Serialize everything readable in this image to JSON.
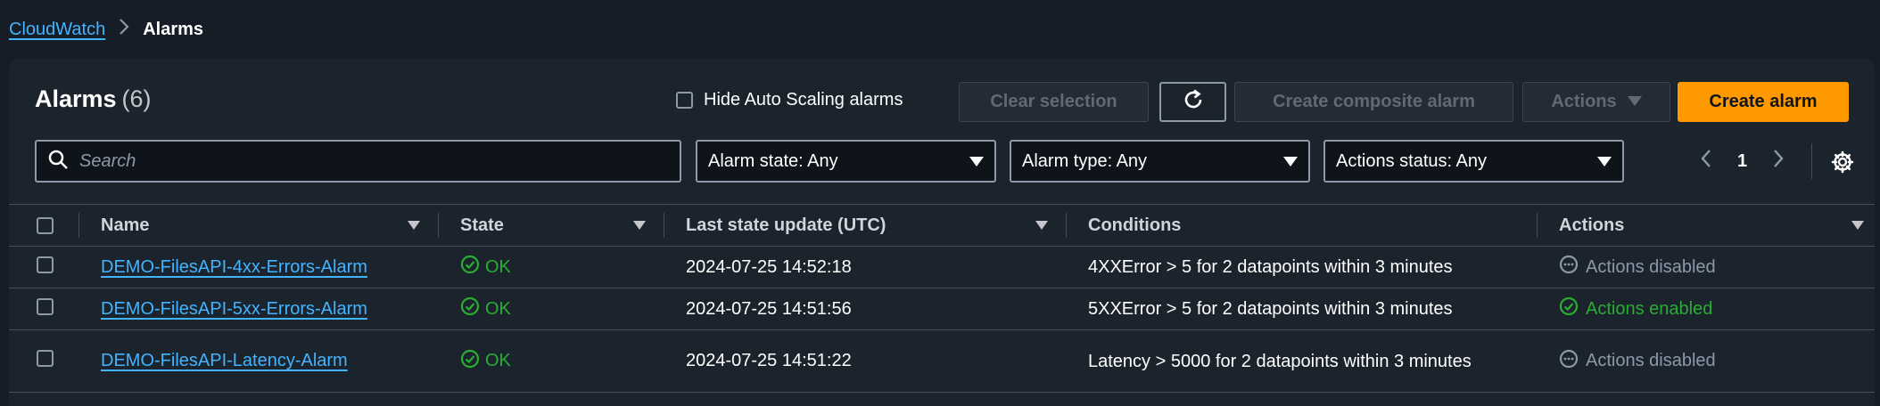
{
  "breadcrumb": {
    "root": "CloudWatch",
    "separator": ">",
    "current": "Alarms"
  },
  "header": {
    "title": "Alarms",
    "count": "(6)"
  },
  "toolbar": {
    "hide_autoscaling_label": "Hide Auto Scaling alarms",
    "clear_selection": "Clear selection",
    "create_composite": "Create composite alarm",
    "actions": "Actions",
    "create_alarm": "Create alarm"
  },
  "filters": {
    "search_placeholder": "Search",
    "alarm_state": "Alarm state: Any",
    "alarm_type": "Alarm type: Any",
    "actions_status": "Actions status: Any"
  },
  "pagination": {
    "page": "1"
  },
  "table": {
    "columns": [
      "Name",
      "State",
      "Last state update (UTC)",
      "Conditions",
      "Actions"
    ],
    "rows": [
      {
        "name": "DEMO-FilesAPI-4xx-Errors-Alarm",
        "state": "OK",
        "updated": "2024-07-25 14:52:18",
        "condition": "4XXError > 5 for 2 datapoints within 3 minutes",
        "actions": "Actions disabled"
      },
      {
        "name": "DEMO-FilesAPI-5xx-Errors-Alarm",
        "state": "OK",
        "updated": "2024-07-25 14:51:56",
        "condition": "5XXError > 5 for 2 datapoints within 3 minutes",
        "actions": "Actions enabled"
      },
      {
        "name": "DEMO-FilesAPI-Latency-Alarm",
        "state": "OK",
        "updated": "2024-07-25 14:51:22",
        "condition": "Latency > 5000 for 2 datapoints within 3 minutes",
        "actions": "Actions disabled"
      }
    ]
  },
  "colors": {
    "accent": "#ff9900",
    "link": "#42b4ff",
    "success": "#29ad32",
    "background": "#161d26"
  }
}
